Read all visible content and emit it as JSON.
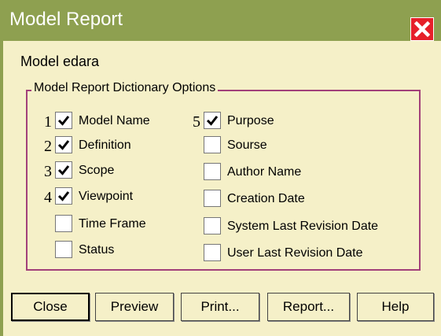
{
  "window": {
    "title": "Model Report"
  },
  "model_line": "Model edara",
  "group": {
    "legend": "Model Report Dictionary Options"
  },
  "options_left": [
    {
      "num": "1",
      "label": "Model Name",
      "checked": true
    },
    {
      "num": "2",
      "label": "Definition",
      "checked": true
    },
    {
      "num": "3",
      "label": "Scope",
      "checked": true
    },
    {
      "num": "4",
      "label": "Viewpoint",
      "checked": true
    },
    {
      "num": "",
      "label": "Time Frame",
      "checked": false
    },
    {
      "num": "",
      "label": "Status",
      "checked": false
    }
  ],
  "options_right": [
    {
      "num": "5",
      "label": "Purpose",
      "checked": true
    },
    {
      "num": "",
      "label": "Sourse",
      "checked": false
    },
    {
      "num": "",
      "label": "Author Name",
      "checked": false
    },
    {
      "num": "",
      "label": "Creation Date",
      "checked": false
    },
    {
      "num": "",
      "label": "System Last Revision Date",
      "checked": false
    },
    {
      "num": "",
      "label": "User Last Revision Date",
      "checked": false
    }
  ],
  "buttons": {
    "close": "Close",
    "preview": "Preview",
    "print": "Print...",
    "report": "Report...",
    "help": "Help"
  },
  "colors": {
    "titlebar": "#8ea050",
    "dialog_bg": "#f5f0c8",
    "group_border": "#a2407a",
    "close_button": "#e6202a"
  },
  "icons": {
    "close": "close-x-icon",
    "check": "checkmark-icon"
  }
}
